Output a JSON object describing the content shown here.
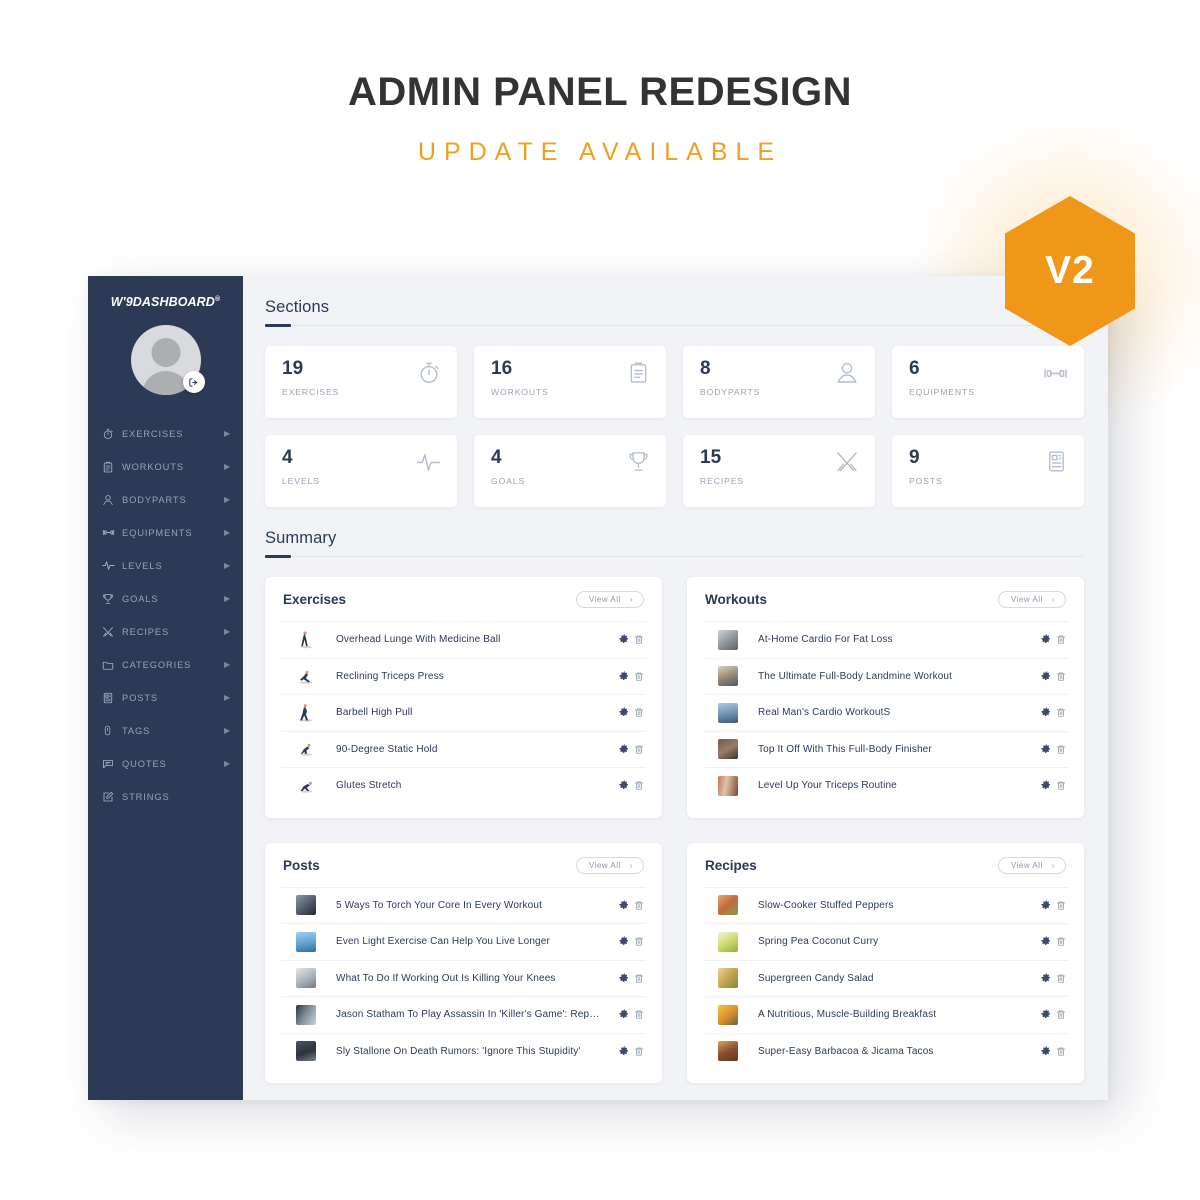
{
  "promo": {
    "title": "ADMIN PANEL REDESIGN",
    "subtitle": "UPDATE AVAILABLE",
    "badge": "V2",
    "accent_color": "#f0a020",
    "title_color": "#333333"
  },
  "sidebar": {
    "logo": "W'9DASHBOARD",
    "logo_mark": "®",
    "background_color": "#2d3a55",
    "avatar_name": "avatar",
    "items": [
      {
        "label": "EXERCISES",
        "icon": "stopwatch-icon",
        "has_caret": true
      },
      {
        "label": "WORKOUTS",
        "icon": "clipboard-icon",
        "has_caret": true
      },
      {
        "label": "BODYPARTS",
        "icon": "person-icon",
        "has_caret": true
      },
      {
        "label": "EQUIPMENTS",
        "icon": "dumbbell-icon",
        "has_caret": true
      },
      {
        "label": "LEVELS",
        "icon": "pulse-icon",
        "has_caret": true
      },
      {
        "label": "GOALS",
        "icon": "trophy-icon",
        "has_caret": true
      },
      {
        "label": "RECIPES",
        "icon": "cutlery-icon",
        "has_caret": true
      },
      {
        "label": "CATEGORIES",
        "icon": "folder-icon",
        "has_caret": true
      },
      {
        "label": "POSTS",
        "icon": "article-icon",
        "has_caret": true
      },
      {
        "label": "TAGS",
        "icon": "tag-icon",
        "has_caret": true
      },
      {
        "label": "QUOTES",
        "icon": "quote-icon",
        "has_caret": true
      },
      {
        "label": "STRINGS",
        "icon": "edit-icon",
        "has_caret": false
      }
    ]
  },
  "main": {
    "sections_heading": "Sections",
    "summary_heading": "Summary",
    "stats": [
      {
        "value": "19",
        "label": "EXERCISES",
        "icon": "stopwatch-icon"
      },
      {
        "value": "16",
        "label": "WORKOUTS",
        "icon": "clipboard-icon"
      },
      {
        "value": "8",
        "label": "BODYPARTS",
        "icon": "person-icon"
      },
      {
        "value": "6",
        "label": "EQUIPMENTS",
        "icon": "dumbbell-icon"
      },
      {
        "value": "4",
        "label": "LEVELS",
        "icon": "pulse-icon"
      },
      {
        "value": "4",
        "label": "GOALS",
        "icon": "trophy-icon"
      },
      {
        "value": "15",
        "label": "RECIPES",
        "icon": "cutlery-icon"
      },
      {
        "value": "9",
        "label": "POSTS",
        "icon": "article-icon"
      }
    ],
    "view_all_label": "View All",
    "panels": [
      {
        "title": "Exercises",
        "thumb_kind": "figure",
        "rows": [
          {
            "title": "Overhead Lunge With Medicine Ball"
          },
          {
            "title": "Reclining Triceps Press"
          },
          {
            "title": "Barbell High Pull"
          },
          {
            "title": "90-Degree Static Hold"
          },
          {
            "title": "Glutes Stretch"
          }
        ]
      },
      {
        "title": "Workouts",
        "thumb_kind": "photo",
        "rows": [
          {
            "title": "At-Home Cardio For Fat Loss"
          },
          {
            "title": "The Ultimate Full-Body Landmine Workout"
          },
          {
            "title": "Real Man's Cardio WorkoutS"
          },
          {
            "title": "Top It Off With This Full-Body Finisher"
          },
          {
            "title": "Level Up Your Triceps Routine"
          }
        ]
      },
      {
        "title": "Posts",
        "thumb_kind": "photo",
        "rows": [
          {
            "title": "5 Ways To Torch Your Core In Every Workout"
          },
          {
            "title": "Even Light Exercise Can Help You Live Longer"
          },
          {
            "title": "What To Do If Working Out Is Killing Your Knees"
          },
          {
            "title": "Jason Statham To Play Assassin In 'Killer's Game': Rep…"
          },
          {
            "title": "Sly Stallone On Death Rumors: 'Ignore This Stupidity'"
          }
        ]
      },
      {
        "title": "Recipes",
        "thumb_kind": "photo",
        "rows": [
          {
            "title": "Slow-Cooker Stuffed Peppers"
          },
          {
            "title": "Spring Pea Coconut Curry"
          },
          {
            "title": "Supergreen Candy Salad"
          },
          {
            "title": "A Nutritious, Muscle-Building Breakfast"
          },
          {
            "title": "Super-Easy Barbacoa & Jicama Tacos"
          }
        ]
      }
    ],
    "row_actions": {
      "settings": "gear-icon",
      "delete": "trash-icon"
    }
  }
}
